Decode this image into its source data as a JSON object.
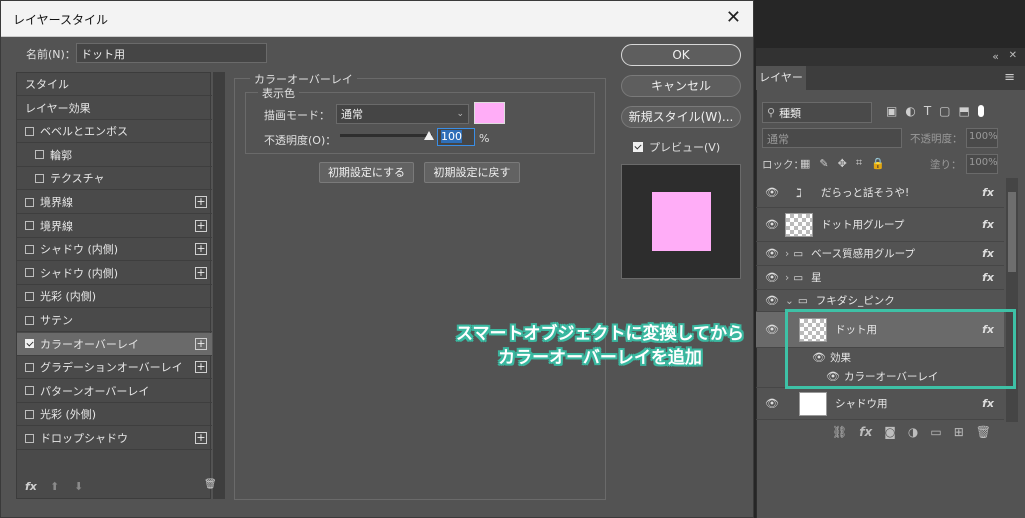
{
  "dialog": {
    "title": "レイヤースタイル",
    "close_glyph": "✕",
    "name_label": "名前(N)：",
    "name_value": "ドット用",
    "buttons": {
      "ok": "OK",
      "cancel": "キャンセル",
      "new_style": "新規スタイル(W)...",
      "preview": "プレビュー(V)"
    },
    "preview_checked": true,
    "style_list": [
      {
        "label": "スタイル",
        "checkbox": false,
        "plus": false,
        "indent": 0,
        "selected": false,
        "checked": false
      },
      {
        "label": "レイヤー効果",
        "checkbox": false,
        "plus": false,
        "indent": 0,
        "selected": false,
        "checked": false
      },
      {
        "label": "ベベルとエンボス",
        "checkbox": true,
        "plus": false,
        "indent": 0,
        "selected": false,
        "checked": false
      },
      {
        "label": "輪郭",
        "checkbox": true,
        "plus": false,
        "indent": 1,
        "selected": false,
        "checked": false
      },
      {
        "label": "テクスチャ",
        "checkbox": true,
        "plus": false,
        "indent": 1,
        "selected": false,
        "checked": false
      },
      {
        "label": "境界線",
        "checkbox": true,
        "plus": true,
        "indent": 0,
        "selected": false,
        "checked": false
      },
      {
        "label": "境界線",
        "checkbox": true,
        "plus": true,
        "indent": 0,
        "selected": false,
        "checked": false
      },
      {
        "label": "シャドウ (内側)",
        "checkbox": true,
        "plus": true,
        "indent": 0,
        "selected": false,
        "checked": false
      },
      {
        "label": "シャドウ (内側)",
        "checkbox": true,
        "plus": true,
        "indent": 0,
        "selected": false,
        "checked": false
      },
      {
        "label": "光彩 (内側)",
        "checkbox": true,
        "plus": false,
        "indent": 0,
        "selected": false,
        "checked": false
      },
      {
        "label": "サテン",
        "checkbox": true,
        "plus": false,
        "indent": 0,
        "selected": false,
        "checked": false
      },
      {
        "label": "カラーオーバーレイ",
        "checkbox": true,
        "plus": true,
        "indent": 0,
        "selected": true,
        "checked": true
      },
      {
        "label": "グラデーションオーバーレイ",
        "checkbox": true,
        "plus": true,
        "indent": 0,
        "selected": false,
        "checked": false
      },
      {
        "label": "パターンオーバーレイ",
        "checkbox": true,
        "plus": false,
        "indent": 0,
        "selected": false,
        "checked": false
      },
      {
        "label": "光彩 (外側)",
        "checkbox": true,
        "plus": false,
        "indent": 0,
        "selected": false,
        "checked": false
      },
      {
        "label": "ドロップシャドウ",
        "checkbox": true,
        "plus": true,
        "indent": 0,
        "selected": false,
        "checked": false
      }
    ],
    "footer_icons": {
      "fx": "fx",
      "up": "⬆",
      "down": "⬇",
      "trash": "🗑"
    },
    "overlay": {
      "section_title": "カラーオーバーレイ",
      "group_title": "表示色",
      "blend_label": "描画モード：",
      "blend_value": "通常",
      "overlay_color": "#ffadf7",
      "opacity_label": "不透明度(O)：",
      "opacity_value": "100",
      "opacity_unit": "%",
      "opacity_fraction": 1.0,
      "reset_default_btn": "初期設定にする",
      "restore_default_btn": "初期設定に戻す"
    }
  },
  "layers_panel": {
    "tab_label": "レイヤー",
    "collapse_glyph": "«",
    "close_glyph": "✕",
    "menu_glyph": "≡",
    "filter_label": "種類",
    "blend_mode": "通常",
    "opacity_label": "不透明度：",
    "opacity_value": "100%",
    "lock_label": "ロック：",
    "fill_label": "塗り：",
    "fill_value": "100%",
    "layers": [
      {
        "name": "だらっと話そうや!",
        "kind": "text",
        "fx": true
      },
      {
        "name": "ドット用グループ",
        "kind": "smart",
        "fx": true
      },
      {
        "name": "ベース質感用グループ",
        "kind": "folder",
        "fx": true
      },
      {
        "name": "星",
        "kind": "folder",
        "fx": true
      },
      {
        "name": "フキダシ_ピンク",
        "kind": "folder-open",
        "fx": false
      },
      {
        "name": "ドット用",
        "kind": "smart-selected",
        "fx": true
      },
      {
        "name": "効果",
        "kind": "effect-head",
        "fx": false
      },
      {
        "name": "カラーオーバーレイ",
        "kind": "effect",
        "fx": false
      },
      {
        "name": "シャドウ用",
        "kind": "smart-white",
        "fx": true
      }
    ],
    "fx_glyph": "fx"
  },
  "annotation": {
    "line1": "スマートオブジェクトに変換してから",
    "line2": "カラーオーバーレイを追加",
    "accent_color": "#3ec1a6"
  }
}
